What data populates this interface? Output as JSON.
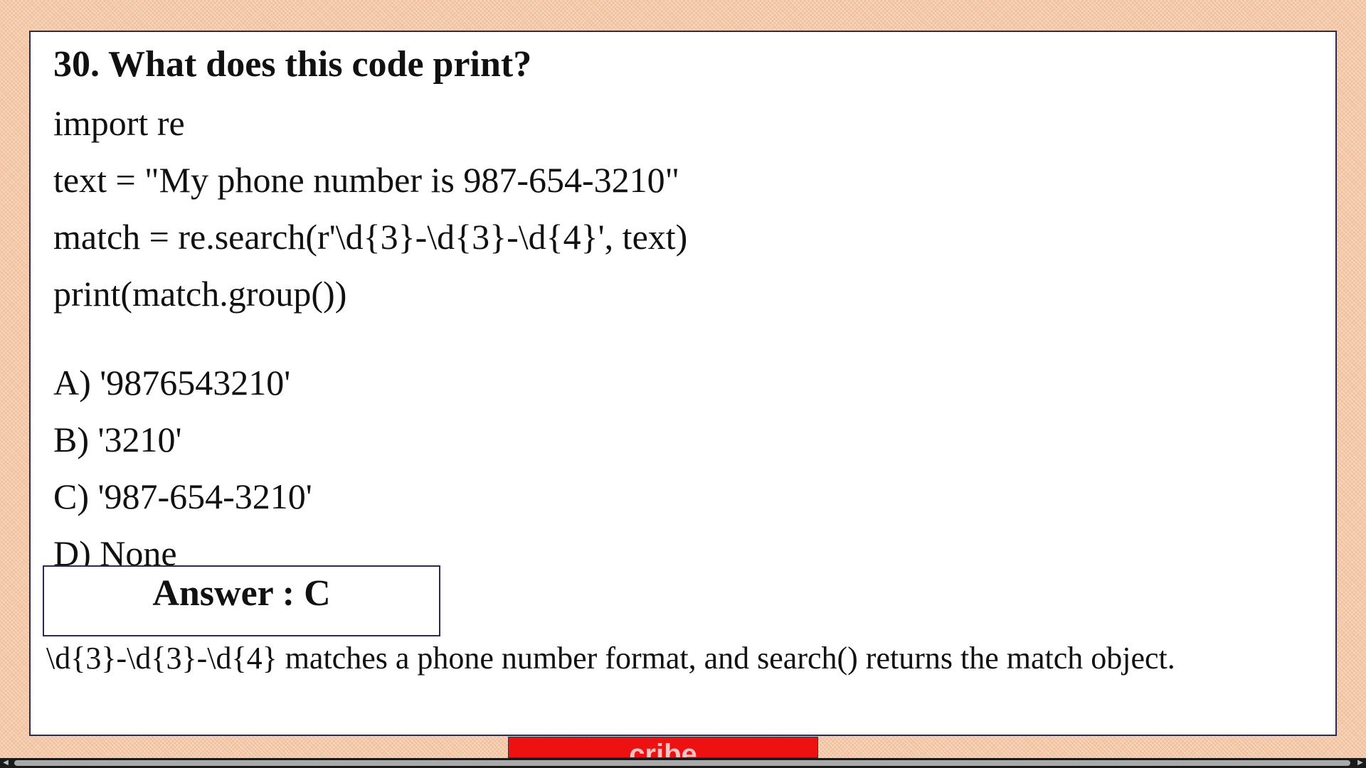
{
  "question": {
    "title": "30. What does this code print?",
    "code_lines": [
      "import re",
      "text = \"My phone number is 987-654-3210\"",
      "match = re.search(r'\\d{3}-\\d{3}-\\d{4}', text)",
      "print(match.group())"
    ]
  },
  "options": [
    "A) '9876543210'",
    "B) '3210'",
    "C) '987-654-3210'",
    "D) None"
  ],
  "answer": {
    "label": "Answer : C"
  },
  "explanation": "\\d{3}-\\d{3}-\\d{4} matches a phone number format, and search() returns the match object.",
  "footer_tab": {
    "text": "cribe"
  },
  "colors": {
    "background": "#f4c9a8",
    "slide_border": "#2a2a55",
    "tab_red": "#ee1111"
  },
  "icons": {
    "scroll_left": "arrow-left-icon",
    "scroll_right": "arrow-right-icon"
  }
}
